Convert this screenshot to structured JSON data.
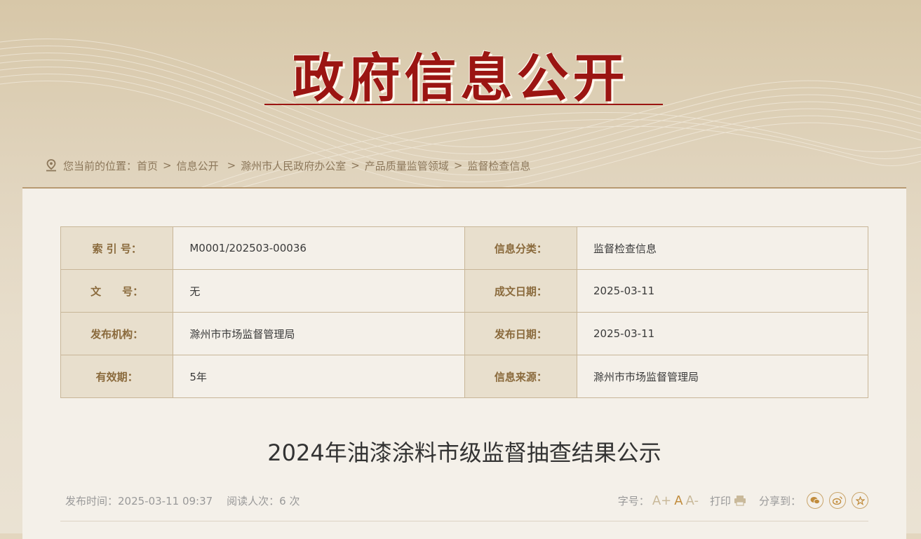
{
  "header": {
    "title": "政府信息公开"
  },
  "breadcrumb": {
    "label": "您当前的位置：",
    "items": [
      "首页",
      "信息公开",
      "滁州市人民政府办公室",
      "产品质量监管领域",
      "监督检查信息"
    ]
  },
  "meta": {
    "rows": [
      {
        "k1": "索 引 号：",
        "v1": "M0001/202503-00036",
        "k2": "信息分类：",
        "v2": "监督检查信息"
      },
      {
        "k1": "文　　号：",
        "v1": "无",
        "k2": "成文日期：",
        "v2": "2025-03-11"
      },
      {
        "k1": "发布机构：",
        "v1": "滁州市市场监督管理局",
        "k2": "发布日期：",
        "v2": "2025-03-11"
      },
      {
        "k1": "有效期：",
        "v1": "5年",
        "k2": "信息来源：",
        "v2": "滁州市市场监督管理局"
      }
    ]
  },
  "article": {
    "title": "2024年油漆涂料市级监督抽查结果公示",
    "publish_time": "发布时间：2025-03-11 09:37",
    "read_count": "阅读人次：6 次",
    "font_size_label": "字号：",
    "font_large": "A+",
    "font_medium": "A",
    "font_small": "A-",
    "print_label": "打印",
    "share_label": "分享到："
  },
  "colors": {
    "brand_red": "#9b1512",
    "label_brown": "#8a6a3c"
  }
}
